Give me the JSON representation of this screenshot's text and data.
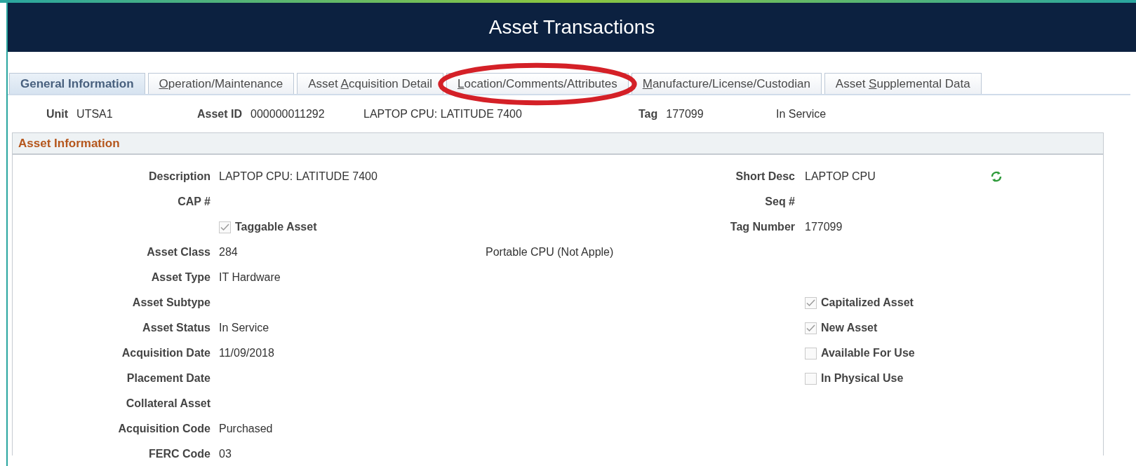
{
  "window": {
    "title": "Asset Transactions"
  },
  "tabs": [
    {
      "label_before": "General Information",
      "selected": true,
      "circled": false
    },
    {
      "access_key": "O",
      "label_after": "peration/Maintenance",
      "selected": false,
      "circled": false
    },
    {
      "label_before": "Asset ",
      "access_key": "A",
      "label_after": "cquisition Detail",
      "selected": false,
      "circled": false
    },
    {
      "access_key": "L",
      "label_after": "ocation/Comments/Attributes",
      "selected": false,
      "circled": true
    },
    {
      "access_key": "M",
      "label_after": "anufacture/License/Custodian",
      "selected": false,
      "circled": false
    },
    {
      "label_before": "Asset ",
      "access_key": "S",
      "label_after": "upplemental Data",
      "selected": false,
      "circled": false
    }
  ],
  "header_items": [
    {
      "kind": "pair",
      "label": "Unit",
      "value": "UTSA1"
    },
    {
      "kind": "pair",
      "label": "Asset ID",
      "value": "000000011292"
    },
    {
      "kind": "text",
      "value": "LAPTOP CPU: LATITUDE 7400"
    },
    {
      "kind": "pair",
      "label": "Tag",
      "value": "177099"
    },
    {
      "kind": "text",
      "value": "In Service"
    }
  ],
  "section": {
    "title": "Asset Information",
    "rows": [
      {
        "left": {
          "kind": "field",
          "label": "Description",
          "value": "LAPTOP CPU: LATITUDE 7400"
        },
        "right": {
          "kind": "field",
          "label": "Short Desc",
          "value": "LAPTOP CPU",
          "refresh": true
        }
      },
      {
        "left": {
          "kind": "field",
          "label": "CAP #"
        },
        "right": {
          "kind": "field",
          "label": "Seq #"
        }
      },
      {
        "left": {
          "kind": "checkbox",
          "label": "Taggable Asset",
          "checked": true
        },
        "right": {
          "kind": "field",
          "label": "Tag Number",
          "value": "177099"
        }
      },
      {
        "left": {
          "kind": "field",
          "label": "Asset Class",
          "value": "284",
          "note": "Portable CPU (Not Apple)"
        }
      },
      {
        "left": {
          "kind": "field",
          "label": "Asset Type",
          "value": "IT Hardware"
        }
      },
      {
        "left": {
          "kind": "field",
          "label": "Asset Subtype"
        },
        "right": {
          "kind": "checkbox",
          "label": "Capitalized Asset",
          "checked": true
        }
      },
      {
        "left": {
          "kind": "field",
          "label": "Asset Status",
          "value": "In Service"
        },
        "right": {
          "kind": "checkbox",
          "label": "New Asset",
          "checked": true
        }
      },
      {
        "left": {
          "kind": "field",
          "label": "Acquisition Date",
          "value": "11/09/2018"
        },
        "right": {
          "kind": "checkbox",
          "label": "Available For Use",
          "checked": false
        }
      },
      {
        "left": {
          "kind": "field",
          "label": "Placement Date"
        },
        "right": {
          "kind": "checkbox",
          "label": "In Physical Use",
          "checked": false
        }
      },
      {
        "left": {
          "kind": "field",
          "label": "Collateral Asset"
        }
      },
      {
        "left": {
          "kind": "field",
          "label": "Acquisition Code",
          "value": "Purchased"
        }
      },
      {
        "left": {
          "kind": "field",
          "label": "FERC Code",
          "value": "03"
        }
      }
    ]
  }
}
